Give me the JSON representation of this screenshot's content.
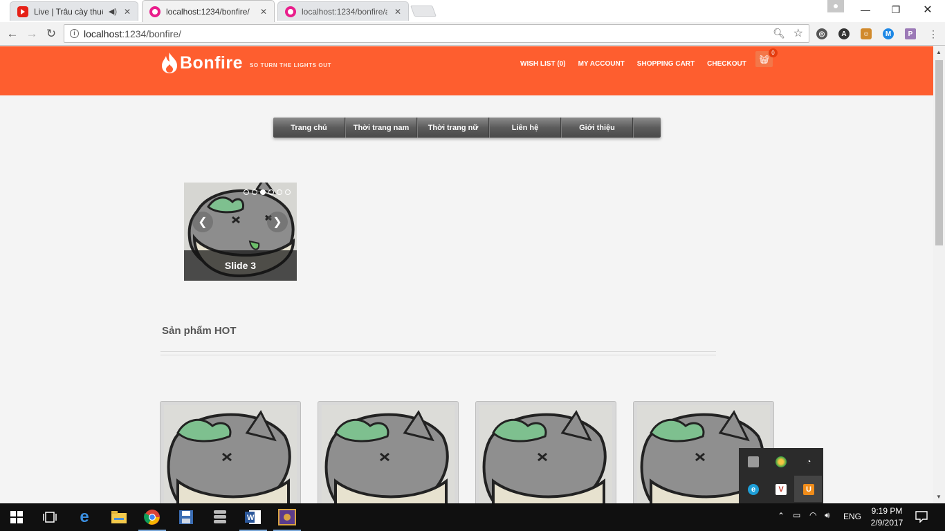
{
  "browser": {
    "tabs": [
      {
        "title": "Live | Trâu cày thuê | f",
        "favicon": "youtube-icon",
        "audio": true,
        "active": false
      },
      {
        "title": "localhost:1234/bonfire/",
        "favicon": "site-icon",
        "audio": false,
        "active": true
      },
      {
        "title": "localhost:1234/bonfire/a",
        "favicon": "site-icon",
        "audio": false,
        "active": false
      }
    ],
    "url_host": "localhost",
    "url_rest": ":1234/bonfire/"
  },
  "site": {
    "brand": "Bonfire",
    "tagline": "SO TURN THE LIGHTS OUT",
    "top_links": [
      "WISH LIST (0)",
      "MY ACCOUNT",
      "SHOPPING CART",
      "CHECKOUT"
    ],
    "cart_count": "0",
    "nav": [
      "Trang chủ",
      "Thời trang nam",
      "Thời trang nữ",
      "Liên hệ",
      "Giới thiệu"
    ],
    "slider": {
      "caption": "Slide 3",
      "dots": 6,
      "active_dot": 3
    },
    "hot_title": "Sản phẩm HOT",
    "colors": {
      "header": "#fe5e2f",
      "nav": "#5c5c5c"
    }
  },
  "taskbar": {
    "apps": [
      "start-icon",
      "task-view-icon",
      "edge-icon",
      "file-explorer-icon",
      "chrome-icon",
      "save-app-icon",
      "stack-app-icon",
      "word-icon",
      "game-app-icon"
    ],
    "language": "ENG",
    "time": "9:19 PM",
    "date": "2/9/2017"
  }
}
